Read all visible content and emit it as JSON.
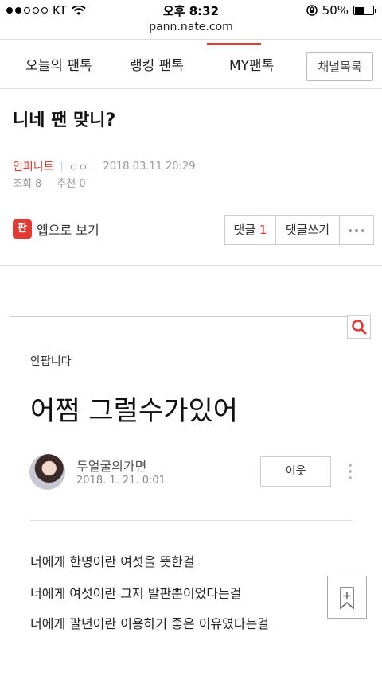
{
  "status_bar": {
    "carrier": "KT",
    "time": "오후 8:32",
    "battery": "50%"
  },
  "url": "pann.nate.com",
  "tabs": [
    {
      "label": "오늘의 팬톡"
    },
    {
      "label": "랭킹 팬톡"
    },
    {
      "label": "MY팬톡"
    }
  ],
  "channel_button": "채널목록",
  "post": {
    "title": "니네 팬 맞니?",
    "category": "인피니트",
    "author": "ㅇㅇ",
    "datetime": "2018.03.11 20:29",
    "views": "조회 8",
    "recommend": "추천 0"
  },
  "actions": {
    "app_view": "앱으로 보기",
    "app_icon_text": "판",
    "comment_label": "댓글",
    "comment_count": "1",
    "write_comment": "댓글쓰기"
  },
  "content": {
    "kicker": "안팝니다",
    "title": "어쩜 그럴수가있어",
    "author": "두얼굴의가면",
    "date": "2018. 1. 21. 0:01",
    "neighbor_button": "이웃",
    "lines": [
      "너에게 한명이란 여섯을 뜻한걸",
      "너에게 여섯이란 그저 발판뿐이었다는걸",
      "너에게 팔년이란 이용하기 좋은 이유였다는걸"
    ]
  },
  "colors": {
    "accent": "#e53935"
  }
}
